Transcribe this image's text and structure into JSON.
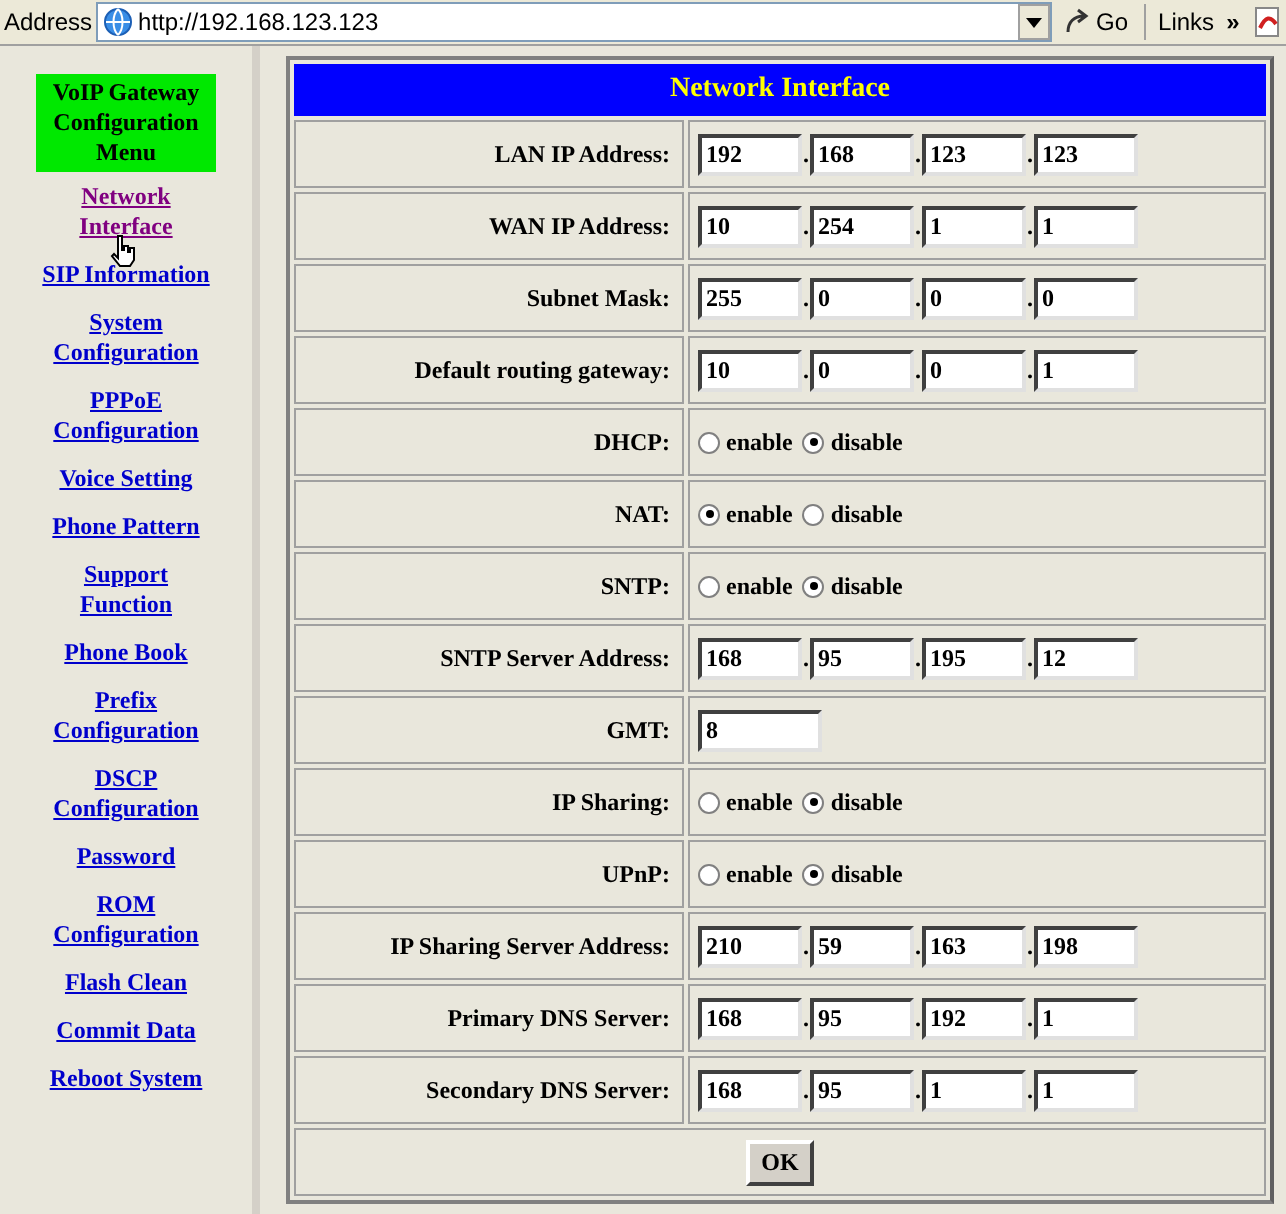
{
  "address_bar": {
    "label": "Address",
    "url": "http://192.168.123.123",
    "go": "Go",
    "links": "Links",
    "chevron": "»"
  },
  "sidebar": {
    "title": "VoIP Gateway Configuration Menu",
    "items": [
      {
        "label": "Network Interface",
        "selected": true
      },
      {
        "label": "SIP Information",
        "selected": false
      },
      {
        "label": "System Configuration",
        "selected": false
      },
      {
        "label": "PPPoE Configuration",
        "selected": false
      },
      {
        "label": "Voice Setting",
        "selected": false
      },
      {
        "label": "Phone Pattern",
        "selected": false
      },
      {
        "label": "Support Function",
        "selected": false
      },
      {
        "label": "Phone Book",
        "selected": false
      },
      {
        "label": "Prefix Configuration",
        "selected": false
      },
      {
        "label": "DSCP Configuration",
        "selected": false
      },
      {
        "label": "Password",
        "selected": false
      },
      {
        "label": "ROM Configuration",
        "selected": false
      },
      {
        "label": "Flash Clean",
        "selected": false
      },
      {
        "label": "Commit Data",
        "selected": false
      },
      {
        "label": "Reboot System",
        "selected": false
      }
    ]
  },
  "form": {
    "title": "Network Interface",
    "separator": ".",
    "rows": [
      {
        "kind": "ip",
        "label": "LAN IP Address:",
        "values": [
          "192",
          "168",
          "123",
          "123"
        ]
      },
      {
        "kind": "ip",
        "label": "WAN IP Address:",
        "values": [
          "10",
          "254",
          "1",
          "1"
        ]
      },
      {
        "kind": "ip",
        "label": "Subnet Mask:",
        "values": [
          "255",
          "0",
          "0",
          "0"
        ]
      },
      {
        "kind": "ip",
        "label": "Default routing gateway:",
        "values": [
          "10",
          "0",
          "0",
          "1"
        ]
      },
      {
        "kind": "radio",
        "label": "DHCP:",
        "options": [
          {
            "label": "enable",
            "selected": false
          },
          {
            "label": "disable",
            "selected": true
          }
        ]
      },
      {
        "kind": "radio",
        "label": "NAT:",
        "options": [
          {
            "label": "enable",
            "selected": true
          },
          {
            "label": "disable",
            "selected": false
          }
        ]
      },
      {
        "kind": "radio",
        "label": "SNTP:",
        "options": [
          {
            "label": "enable",
            "selected": false
          },
          {
            "label": "disable",
            "selected": true
          }
        ]
      },
      {
        "kind": "ip",
        "label": "SNTP Server Address:",
        "values": [
          "168",
          "95",
          "195",
          "12"
        ]
      },
      {
        "kind": "text",
        "label": "GMT:",
        "value": "8"
      },
      {
        "kind": "radio",
        "label": "IP Sharing:",
        "options": [
          {
            "label": "enable",
            "selected": false
          },
          {
            "label": "disable",
            "selected": true
          }
        ]
      },
      {
        "kind": "radio",
        "label": "UPnP:",
        "options": [
          {
            "label": "enable",
            "selected": false
          },
          {
            "label": "disable",
            "selected": true
          }
        ]
      },
      {
        "kind": "ip",
        "label": "IP Sharing Server Address:",
        "values": [
          "210",
          "59",
          "163",
          "198"
        ]
      },
      {
        "kind": "ip",
        "label": "Primary DNS Server:",
        "values": [
          "168",
          "95",
          "192",
          "1"
        ]
      },
      {
        "kind": "ip",
        "label": "Secondary DNS Server:",
        "values": [
          "168",
          "95",
          "1",
          "1"
        ]
      }
    ],
    "submit": "OK"
  }
}
